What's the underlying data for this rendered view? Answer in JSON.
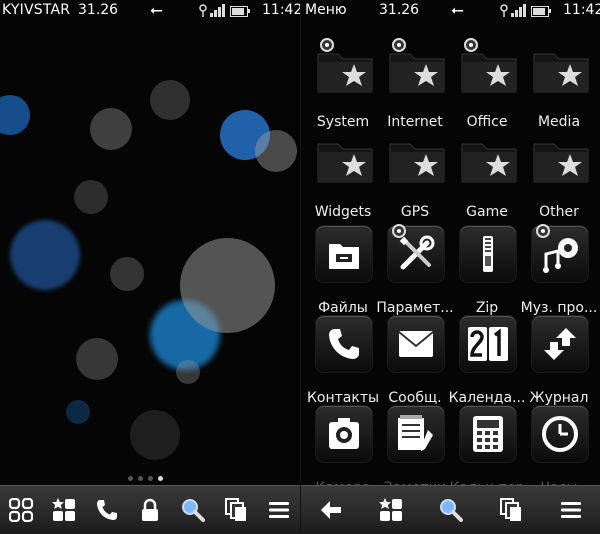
{
  "left_screen": {
    "status": {
      "carrier": "KYIVSTAR",
      "date": "31.26",
      "time": "11:42"
    },
    "page_indicator": {
      "count": 4,
      "active": 3
    },
    "toolbar": [
      {
        "name": "apps-grid-icon"
      },
      {
        "name": "favorites-icon"
      },
      {
        "name": "phone-icon"
      },
      {
        "name": "lock-icon"
      },
      {
        "name": "search-icon"
      },
      {
        "name": "tasks-icon"
      },
      {
        "name": "menu-icon"
      }
    ]
  },
  "right_screen": {
    "status": {
      "title": "Меню",
      "date": "31.26",
      "time": "11:42"
    },
    "items": [
      {
        "label": "System",
        "icon": "folder-star-icon",
        "marked": true
      },
      {
        "label": "Internet",
        "icon": "folder-star-icon",
        "marked": true
      },
      {
        "label": "Office",
        "icon": "folder-star-icon",
        "marked": true
      },
      {
        "label": "Media",
        "icon": "folder-star-icon",
        "marked": false
      },
      {
        "label": "Widgets",
        "icon": "folder-star-icon",
        "marked": false
      },
      {
        "label": "GPS",
        "icon": "folder-star-icon",
        "marked": false
      },
      {
        "label": "Game",
        "icon": "folder-star-icon",
        "marked": false
      },
      {
        "label": "Other",
        "icon": "folder-star-icon",
        "marked": false
      },
      {
        "label": "Файлы",
        "icon": "file-manager-icon",
        "marked": false
      },
      {
        "label": "Парамет...",
        "icon": "settings-tools-icon",
        "marked": true
      },
      {
        "label": "Zip",
        "icon": "zip-icon",
        "marked": false
      },
      {
        "label": "Муз. про...",
        "icon": "music-player-icon",
        "marked": true
      },
      {
        "label": "Контакты",
        "icon": "contacts-phone-icon",
        "marked": false
      },
      {
        "label": "Сообщ.",
        "icon": "messages-icon",
        "marked": false
      },
      {
        "label": "Календа...",
        "icon": "calendar-icon",
        "marked": false
      },
      {
        "label": "Журнал",
        "icon": "log-icon",
        "marked": false
      },
      {
        "label": "Камера",
        "icon": "camera-icon",
        "marked": false
      },
      {
        "label": "Заметки",
        "icon": "notes-icon",
        "marked": false
      },
      {
        "label": "Кальк-тор",
        "icon": "calculator-icon",
        "marked": false
      },
      {
        "label": "Часы",
        "icon": "clock-icon",
        "marked": false
      }
    ],
    "toolbar": [
      {
        "name": "back-icon"
      },
      {
        "name": "favorites-icon"
      },
      {
        "name": "search-icon"
      },
      {
        "name": "tasks-icon"
      },
      {
        "name": "menu-icon"
      }
    ]
  }
}
